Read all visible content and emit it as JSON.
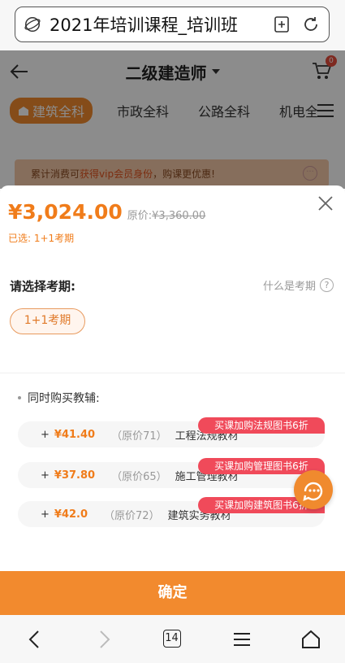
{
  "browser": {
    "url": "2021年培训课程_培训班",
    "tab_count": "14"
  },
  "page": {
    "title": "二级建造师",
    "cart_count": "0",
    "tabs": [
      {
        "label": "建筑全科",
        "active": true
      },
      {
        "label": "市政全科",
        "active": false
      },
      {
        "label": "公路全科",
        "active": false
      },
      {
        "label": "机电全",
        "active": false
      }
    ],
    "banner": {
      "pre": "累计消费可",
      "highlight": "获得vip会员身份",
      "post": "，购课更优惠!"
    }
  },
  "sheet": {
    "price": "¥3,024.00",
    "original_label": "原价:",
    "original_price": "¥3,360.00",
    "selected": "已选:  1+1考期",
    "section_title": "请选择考期:",
    "what_is": "什么是考期",
    "period_option": "1+1考期",
    "addon_title": "同时购买教辅:",
    "items": [
      {
        "price": "¥41.40",
        "orig": "（原价71）",
        "name": "工程法规教材",
        "promo": "买课加购法规图书6折"
      },
      {
        "price": "¥37.80",
        "orig": "（原价65）",
        "name": "施工管理教材",
        "promo": "买课加购管理图书6折"
      },
      {
        "price": "¥42.0",
        "orig": "（原价72）",
        "name": "建筑实务教材",
        "promo": "买课加购建筑图书6折"
      }
    ],
    "confirm": "确定"
  },
  "colors": {
    "accent": "#f28a2e",
    "price": "#f07c1a",
    "promo": "#f04a5a"
  }
}
